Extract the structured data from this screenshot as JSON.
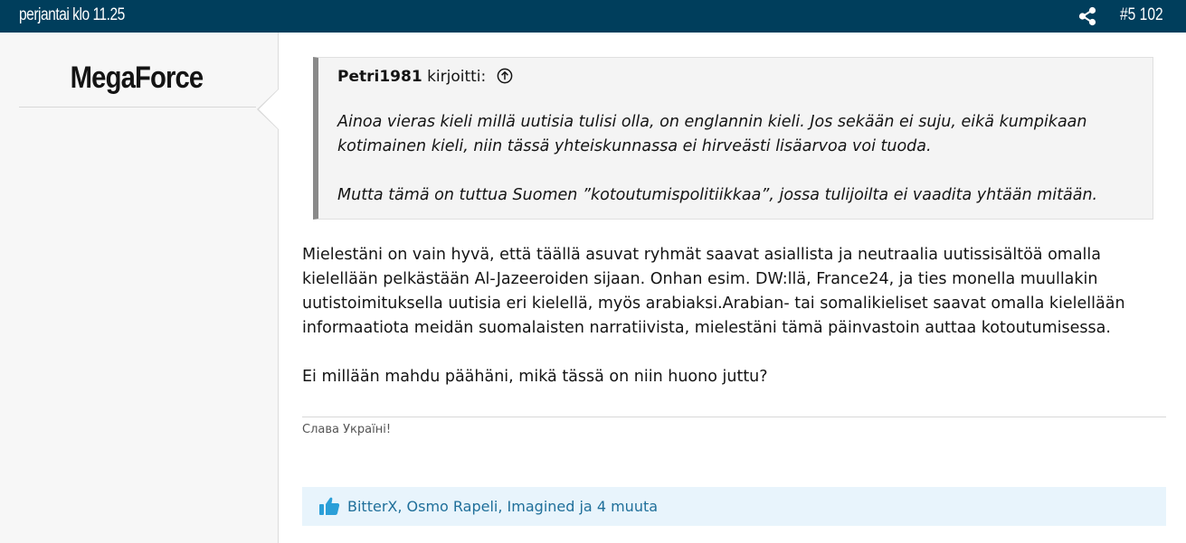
{
  "topbar": {
    "date": "perjantai klo 11.25",
    "share_icon": "share-icon",
    "post_number": "#5 102"
  },
  "author": {
    "username": "MegaForce"
  },
  "quote": {
    "author": "Petri1981",
    "wrote": "kirjoitti:",
    "goto_icon": "arrow-up-circle-icon",
    "paragraphs": [
      "Ainoa vieras kieli millä uutisia tulisi olla, on englannin kieli. Jos sekään ei suju, eikä kumpikaan kotimainen kieli, niin tässä yhteiskunnassa ei hirveästi lisäarvoa voi tuoda.",
      "Mutta tämä on tuttua Suomen ”kotoutumispolitiikkaa”, jossa tulijoilta ei vaadita yhtään mitään."
    ]
  },
  "post": {
    "paragraphs": [
      "Mielestäni on vain hyvä, että täällä asuvat ryhmät saavat asiallista ja neutraalia uutissisältöä omalla kielellään pelkästään Al-Jazeeroiden sijaan. Onhan esim. DW:llä, France24, ja ties monella muullakin uutistoimituksella uutisia eri kielellä, myös arabiaksi.Arabian- tai somalikieliset saavat omalla kielellään informaatiota meidän suomalaisten narratiivista, mielestäni tämä päinvastoin auttaa kotoutumisessa.",
      "Ei millään mahdu päähäni, mikä tässä on niin huono juttu?"
    ],
    "signature": "Слава Україні!"
  },
  "reactions": {
    "icon": "thumbs-up-icon",
    "text": "BitterX, Osmo Rapeli, Imagined ja 4 muuta"
  },
  "colors": {
    "topbar_bg": "#003e5c",
    "link": "#1f6f9a",
    "reaction_bg": "#e8f4fc",
    "thumb": "#2b9fd8"
  }
}
